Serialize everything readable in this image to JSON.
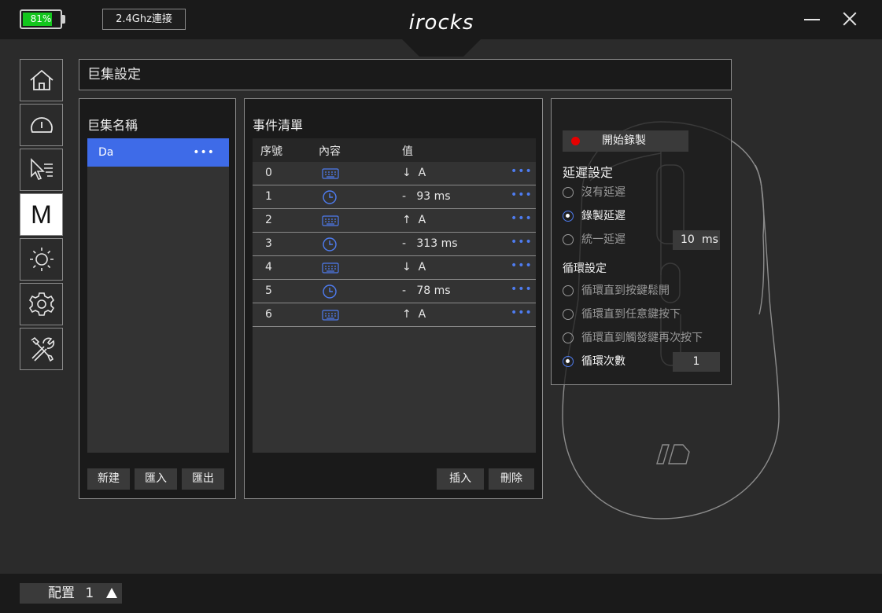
{
  "topbar": {
    "battery_text": "81%",
    "battery_level": 0.81,
    "connection_label": "2.4Ghz連接",
    "logo": "irocks"
  },
  "header": {
    "title": "巨集設定"
  },
  "macro_panel": {
    "title": "巨集名稱",
    "items": [
      {
        "name": "Da",
        "menu": "•••"
      }
    ],
    "buttons": {
      "new": "新建",
      "import": "匯入",
      "export": "匯出"
    }
  },
  "event_panel": {
    "title": "事件清單",
    "columns": {
      "index": "序號",
      "content": "內容",
      "value": "值"
    },
    "rows": [
      {
        "index": "0",
        "type": "keyboard",
        "value": "↓  A",
        "menu": "•••"
      },
      {
        "index": "1",
        "type": "delay",
        "value": "-   93 ms",
        "menu": "•••"
      },
      {
        "index": "2",
        "type": "keyboard",
        "value": "↑  A",
        "menu": "•••"
      },
      {
        "index": "3",
        "type": "delay",
        "value": "-   313 ms",
        "menu": "•••"
      },
      {
        "index": "4",
        "type": "keyboard",
        "value": "↓  A",
        "menu": "•••"
      },
      {
        "index": "5",
        "type": "delay",
        "value": "-   78 ms",
        "menu": "•••"
      },
      {
        "index": "6",
        "type": "keyboard",
        "value": "↑  A",
        "menu": "•••"
      }
    ],
    "buttons": {
      "insert": "插入",
      "delete": "刪除"
    }
  },
  "record_panel": {
    "record_button": "開始錄製",
    "delay_title": "延遲設定",
    "delay_options": [
      {
        "label": "沒有延遲",
        "selected": false
      },
      {
        "label": "錄製延遲",
        "selected": true
      },
      {
        "label": "統一延遲",
        "selected": false
      }
    ],
    "uniform_delay_value": "10",
    "uniform_delay_unit": "ms",
    "loop_title": "循環設定",
    "loop_options": [
      {
        "label": "循環直到按鍵鬆開",
        "selected": false
      },
      {
        "label": "循環直到任意鍵按下",
        "selected": false
      },
      {
        "label": "循環直到觸發鍵再次按下",
        "selected": false
      },
      {
        "label": "循環次數",
        "selected": true
      }
    ],
    "loop_count": "1"
  },
  "bottombar": {
    "profile_label": "配置",
    "profile_number": "1"
  },
  "colors": {
    "accent": "#3e6be8",
    "record_dot": "#e60000",
    "battery": "#13c61d",
    "background": "#2b2b2b",
    "panel": "#1a1a1a"
  },
  "icons": {
    "sidebar": [
      "home-icon",
      "performance-gauge-icon",
      "button-assign-icon",
      "macro-icon",
      "lighting-icon",
      "settings-gear-icon",
      "tools-icon"
    ],
    "event_keyboard": "keyboard-icon",
    "event_delay": "clock-icon"
  }
}
